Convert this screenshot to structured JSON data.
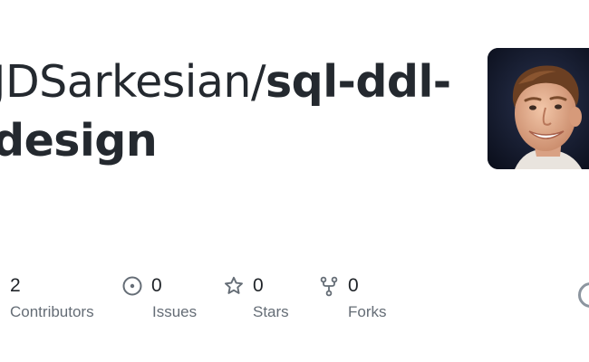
{
  "repo": {
    "owner": "JDSarkesian",
    "separator": "/",
    "name": "sql-ddl-design"
  },
  "stats": [
    {
      "value": "2",
      "label": "Contributors",
      "icon": "people-icon"
    },
    {
      "value": "0",
      "label": "Issues",
      "icon": "issue-opened-icon"
    },
    {
      "value": "0",
      "label": "Stars",
      "icon": "star-icon"
    },
    {
      "value": "0",
      "label": "Forks",
      "icon": "repo-forked-icon"
    }
  ],
  "colors": {
    "title": "#24292f",
    "label": "#656d76",
    "icon": "#656d76",
    "logo": "#8c959f"
  }
}
